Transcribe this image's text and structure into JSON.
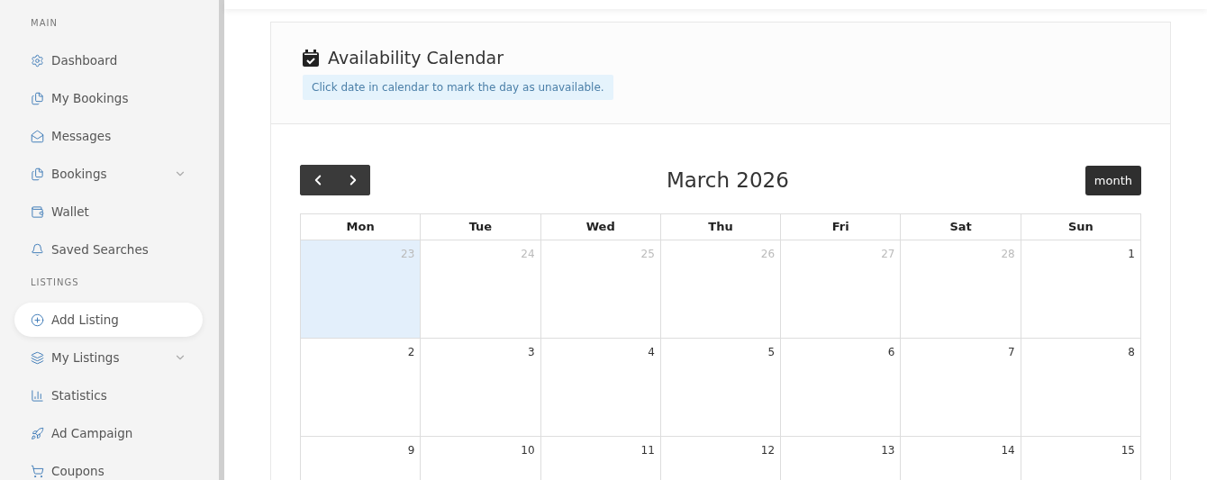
{
  "sidebar": {
    "sections": [
      {
        "heading": "MAIN",
        "items": [
          {
            "label": "Dashboard",
            "selected": false,
            "expandable": false
          },
          {
            "label": "My Bookings",
            "selected": false,
            "expandable": false
          },
          {
            "label": "Messages",
            "selected": false,
            "expandable": false
          },
          {
            "label": "Bookings",
            "selected": false,
            "expandable": true
          },
          {
            "label": "Wallet",
            "selected": false,
            "expandable": false
          },
          {
            "label": "Saved Searches",
            "selected": false,
            "expandable": false
          }
        ]
      },
      {
        "heading": "LISTINGS",
        "items": [
          {
            "label": "Add Listing",
            "selected": true,
            "expandable": false
          },
          {
            "label": "My Listings",
            "selected": false,
            "expandable": true
          },
          {
            "label": "Statistics",
            "selected": false,
            "expandable": false
          },
          {
            "label": "Ad Campaign",
            "selected": false,
            "expandable": false
          },
          {
            "label": "Coupons",
            "selected": false,
            "expandable": false
          }
        ]
      }
    ]
  },
  "card": {
    "title": "Availability Calendar",
    "notice": "Click date in calendar to mark the day as unavailable.",
    "calendar": {
      "title": "March 2026",
      "view_button": "month",
      "weekdays": [
        "Mon",
        "Tue",
        "Wed",
        "Thu",
        "Fri",
        "Sat",
        "Sun"
      ],
      "weeks": [
        [
          {
            "day": "23",
            "other_month": true,
            "today": true
          },
          {
            "day": "24",
            "other_month": true,
            "today": false
          },
          {
            "day": "25",
            "other_month": true,
            "today": false
          },
          {
            "day": "26",
            "other_month": true,
            "today": false
          },
          {
            "day": "27",
            "other_month": true,
            "today": false
          },
          {
            "day": "28",
            "other_month": true,
            "today": false
          },
          {
            "day": "1",
            "other_month": false,
            "today": false
          }
        ],
        [
          {
            "day": "2",
            "other_month": false,
            "today": false
          },
          {
            "day": "3",
            "other_month": false,
            "today": false
          },
          {
            "day": "4",
            "other_month": false,
            "today": false
          },
          {
            "day": "5",
            "other_month": false,
            "today": false
          },
          {
            "day": "6",
            "other_month": false,
            "today": false
          },
          {
            "day": "7",
            "other_month": false,
            "today": false
          },
          {
            "day": "8",
            "other_month": false,
            "today": false
          }
        ],
        [
          {
            "day": "9",
            "other_month": false,
            "today": false
          },
          {
            "day": "10",
            "other_month": false,
            "today": false
          },
          {
            "day": "11",
            "other_month": false,
            "today": false
          },
          {
            "day": "12",
            "other_month": false,
            "today": false
          },
          {
            "day": "13",
            "other_month": false,
            "today": false
          },
          {
            "day": "14",
            "other_month": false,
            "today": false
          },
          {
            "day": "15",
            "other_month": false,
            "today": false
          }
        ]
      ]
    }
  }
}
